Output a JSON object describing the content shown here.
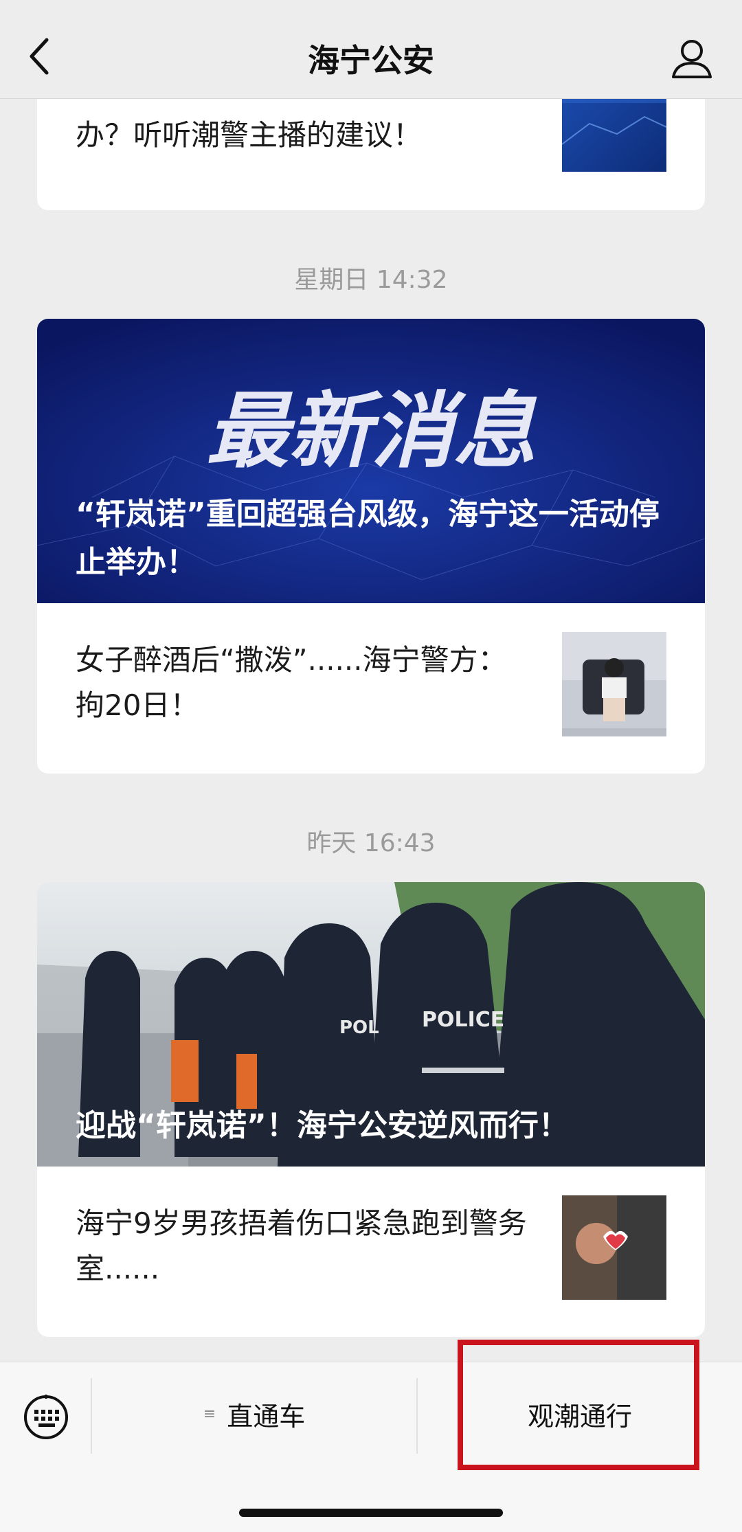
{
  "header": {
    "title": "海宁公安"
  },
  "articles": {
    "top_partial": "办？听听潮警主播的建议！",
    "group1_time": "星期日 14:32",
    "group1_banner_art": "最新消息",
    "group1_headline": "“轩岚诺”重回超强台风级，海宁这一活动停止举办！",
    "group1_item": "女子醉酒后“撒泼”......海宁警方：拘20日！",
    "group2_time": "昨天 16:43",
    "group2_headline": "迎战“轩岚诺”！海宁公安逆风而行！",
    "group2_item": "海宁9岁男孩捂着伤口紧急跑到警务室......"
  },
  "menu": {
    "item1": "直通车",
    "item2": "观潮通行"
  },
  "icons": [
    "chevron-left-icon",
    "person-icon",
    "keyboard-icon",
    "menu-list-icon"
  ],
  "colors": {
    "highlight": "#c9141e",
    "banner_blue": "#0f1e6e"
  }
}
